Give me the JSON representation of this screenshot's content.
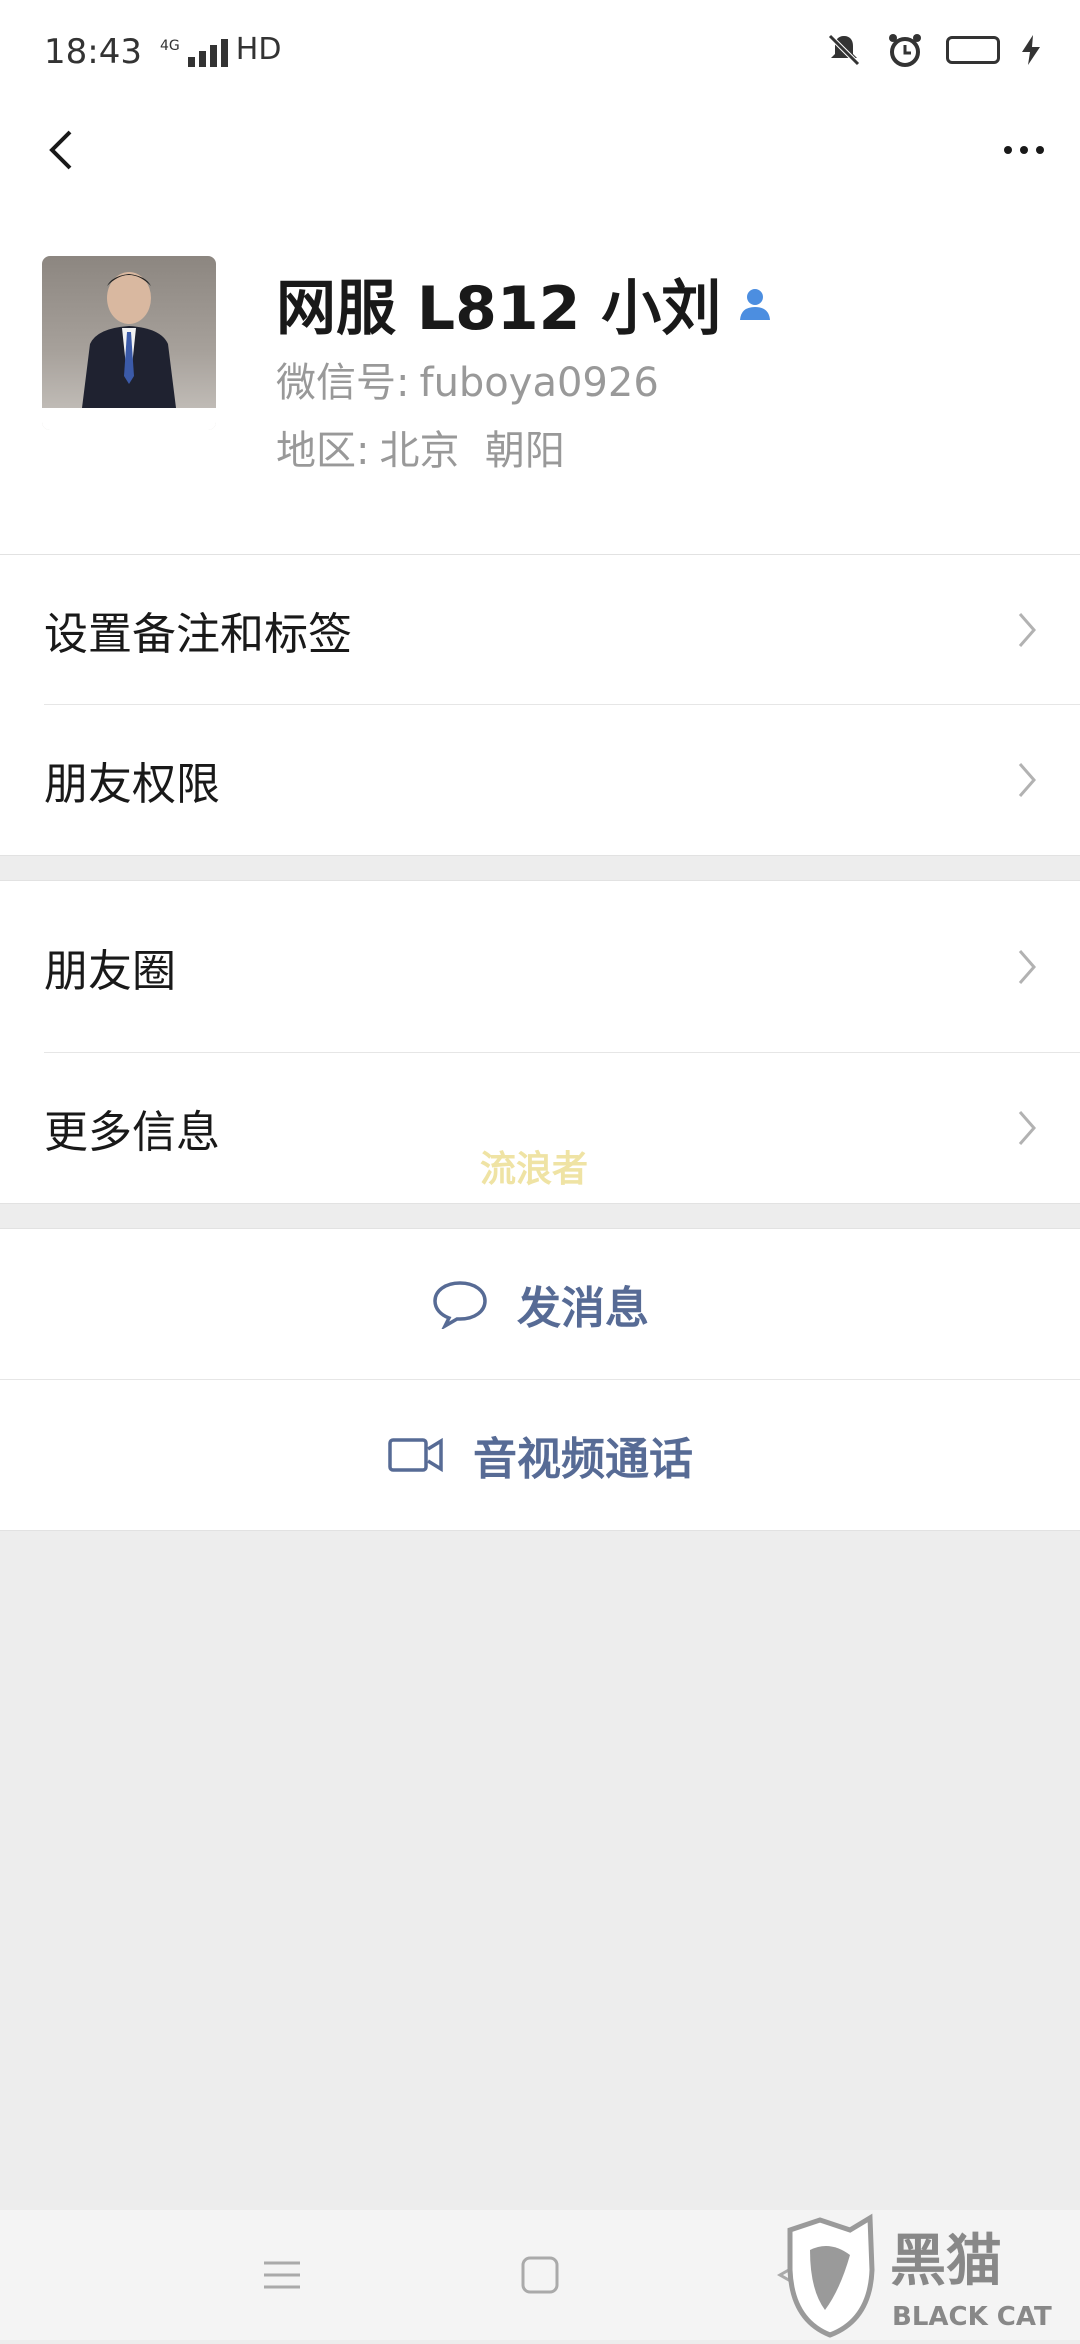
{
  "status": {
    "time": "18:43",
    "network": "4G",
    "hd": "HD"
  },
  "profile": {
    "name": "网服 L812 小刘",
    "wechat_id_label": "微信号:",
    "wechat_id": "fuboya0926",
    "region_label": "地区:",
    "region": "北京  朝阳"
  },
  "group1": [
    {
      "label": "设置备注和标签"
    },
    {
      "label": "朋友权限"
    }
  ],
  "group2": [
    {
      "label": "朋友圈"
    },
    {
      "label": "更多信息"
    }
  ],
  "actions": {
    "message": "发消息",
    "call": "音视频通话"
  },
  "watermark": "流浪者",
  "brand": {
    "cn": "黑猫",
    "en": "BLACK CAT"
  },
  "colors": {
    "link": "#576b95",
    "background": "#ededed"
  }
}
